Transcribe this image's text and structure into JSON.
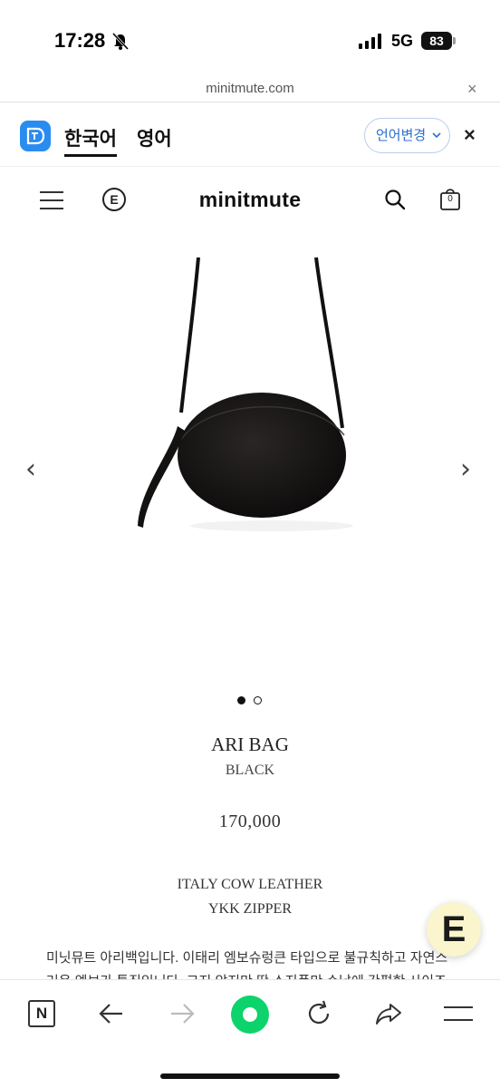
{
  "status_bar": {
    "time": "17:28",
    "network": "5G",
    "battery": "83"
  },
  "url_bar": {
    "domain": "minitmute.com",
    "close": "×"
  },
  "translate_bar": {
    "tabs": [
      {
        "label": "한국어",
        "active": true
      },
      {
        "label": "영어",
        "active": false
      }
    ],
    "change_language_button": "언어변경",
    "close": "×"
  },
  "site_header": {
    "brand": "minitmute",
    "e_badge": "E",
    "cart_count": "0"
  },
  "gallery": {
    "prev": "‹",
    "next": "›",
    "slide_count": 2,
    "active_slide": 1
  },
  "product": {
    "name": "ARI BAG",
    "color": "BLACK",
    "price": "170,000",
    "specs": [
      "ITALY COW LEATHER",
      "YKK ZIPPER"
    ],
    "description": [
      "미닛뮤트 아리백입니다. 이태리 엠보슈렁큰 타입으로 불규칙하고 자연스",
      "러운 엠보가 특징입니다. 크지 않지만 딱 소지품만 수납에 간편한 사이즈"
    ]
  },
  "floating_button": {
    "glyph": "E"
  },
  "toolbar": {
    "n_label": "N",
    "icons": [
      "tabs-icon",
      "back-icon",
      "forward-icon",
      "home-icon",
      "reload-icon",
      "share-icon",
      "menu-icon"
    ]
  },
  "colors": {
    "accent_blue": "#2b8cf0",
    "home_green": "#0cd36b",
    "float_bg": "#faf5cc"
  }
}
